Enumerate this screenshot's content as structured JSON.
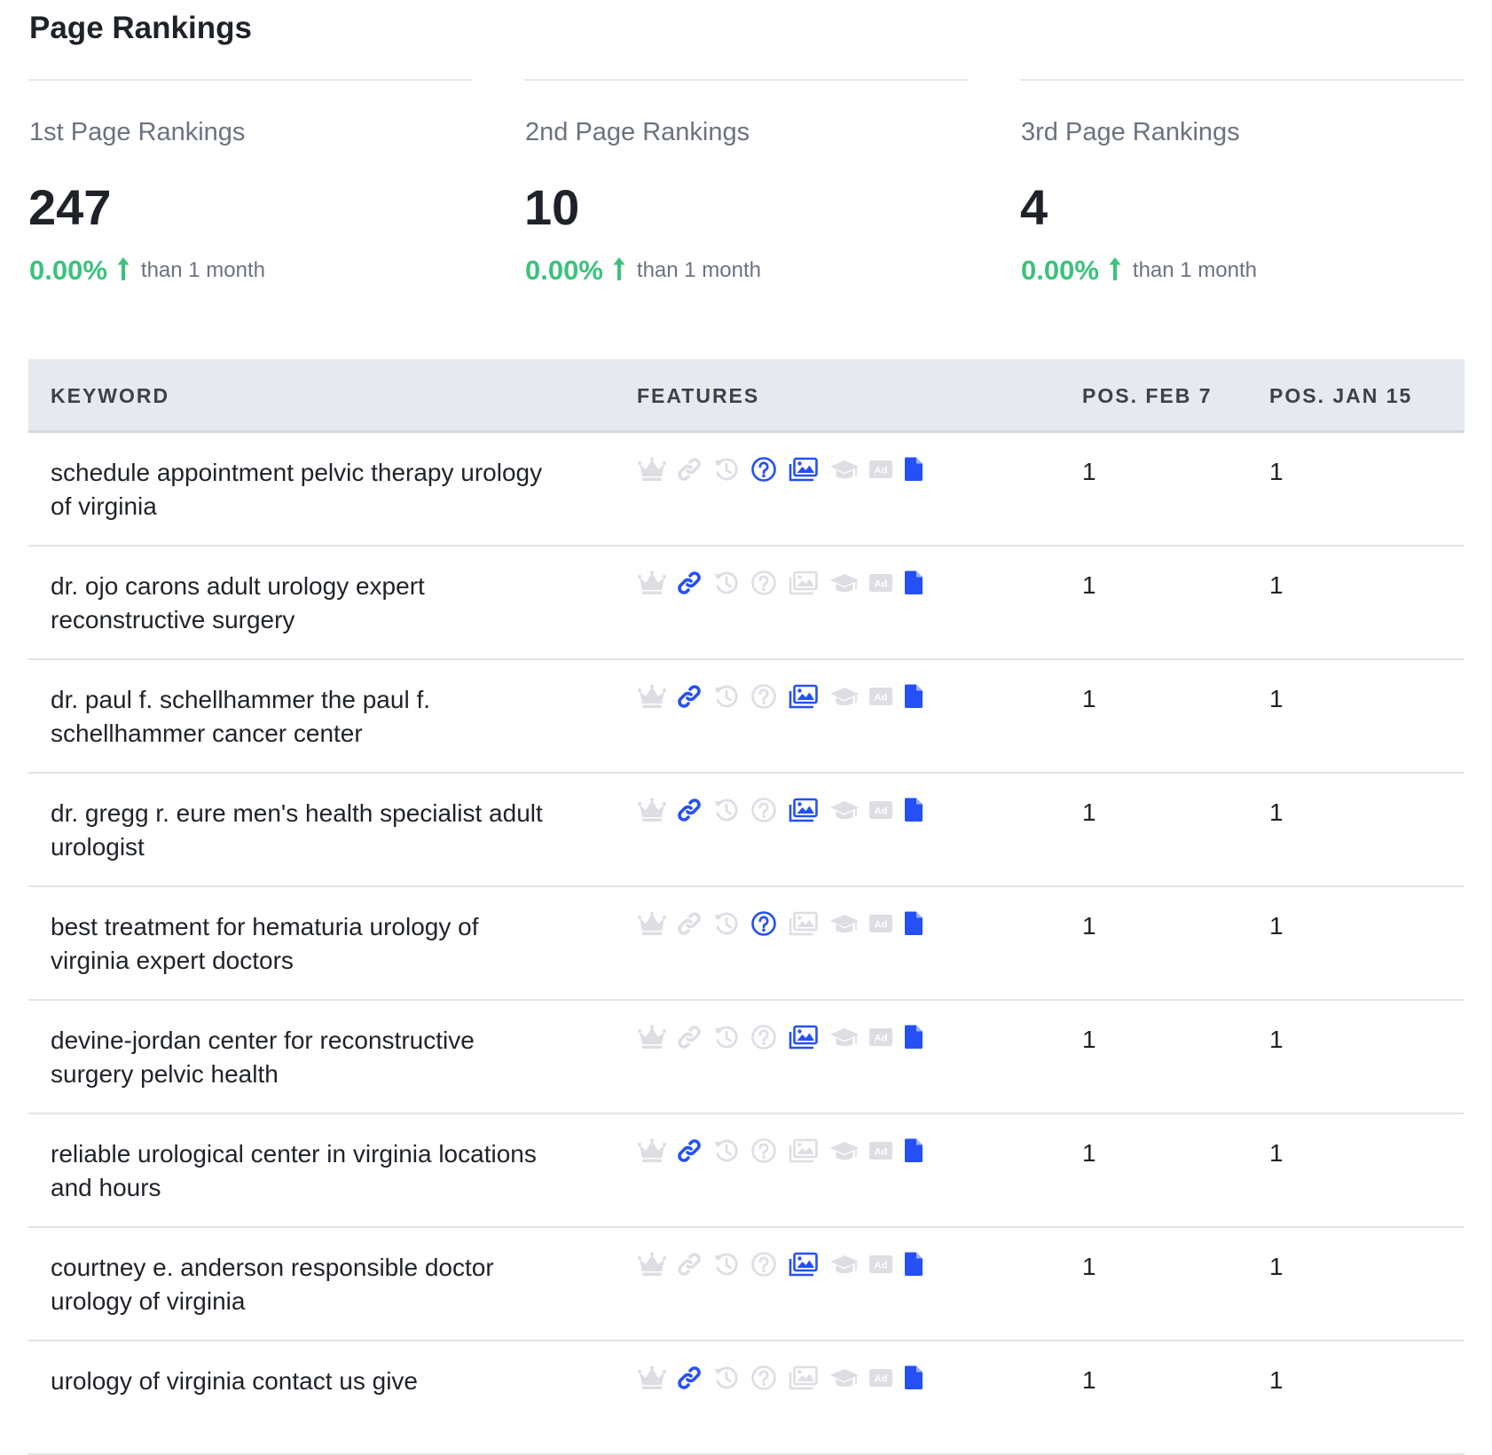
{
  "page": {
    "title": "Page Rankings"
  },
  "stats": [
    {
      "label": "1st Page Rankings",
      "value": "247",
      "change": "0.00%",
      "compare": "than 1 month"
    },
    {
      "label": "2nd Page Rankings",
      "value": "10",
      "change": "0.00%",
      "compare": "than 1 month"
    },
    {
      "label": "3rd Page Rankings",
      "value": "4",
      "change": "0.00%",
      "compare": "than 1 month"
    }
  ],
  "table": {
    "headers": {
      "keyword": "KEYWORD",
      "features": "FEATURES",
      "pos_current": "POS. FEB 7",
      "pos_previous": "POS. JAN 15"
    },
    "feature_icons": [
      "crown-icon",
      "link-icon",
      "history-icon",
      "question-icon",
      "image-icon",
      "graduation-cap-icon",
      "ad-icon",
      "document-icon"
    ],
    "ad_label": "Ad",
    "rows": [
      {
        "keyword": "schedule appointment pelvic therapy urology of virginia",
        "pos_current": "1",
        "pos_previous": "1",
        "active_features": [
          "question-icon",
          "image-icon",
          "document-icon"
        ]
      },
      {
        "keyword": "dr. ojo carons adult urology expert reconstructive surgery",
        "pos_current": "1",
        "pos_previous": "1",
        "active_features": [
          "link-icon",
          "document-icon"
        ]
      },
      {
        "keyword": "dr. paul f. schellhammer the paul f. schellhammer cancer center",
        "pos_current": "1",
        "pos_previous": "1",
        "active_features": [
          "link-icon",
          "image-icon",
          "document-icon"
        ]
      },
      {
        "keyword": "dr. gregg r. eure men's health specialist adult urologist",
        "pos_current": "1",
        "pos_previous": "1",
        "active_features": [
          "link-icon",
          "image-icon",
          "document-icon"
        ]
      },
      {
        "keyword": "best treatment for hematuria urology of virginia expert doctors",
        "pos_current": "1",
        "pos_previous": "1",
        "active_features": [
          "question-icon",
          "document-icon"
        ]
      },
      {
        "keyword": "devine-jordan center for reconstructive surgery pelvic health",
        "pos_current": "1",
        "pos_previous": "1",
        "active_features": [
          "image-icon",
          "document-icon"
        ]
      },
      {
        "keyword": "reliable urological center in virginia locations and hours",
        "pos_current": "1",
        "pos_previous": "1",
        "active_features": [
          "link-icon",
          "document-icon"
        ]
      },
      {
        "keyword": "courtney e. anderson responsible doctor urology of virginia",
        "pos_current": "1",
        "pos_previous": "1",
        "active_features": [
          "image-icon",
          "document-icon"
        ]
      },
      {
        "keyword": "urology of virginia contact us give",
        "pos_current": "1",
        "pos_previous": "1",
        "active_features": [
          "link-icon",
          "document-icon"
        ]
      }
    ]
  },
  "colors": {
    "accent_blue": "#2550f5",
    "inactive_icon": "#dcdee3",
    "positive_green": "#3ac27c",
    "header_bg": "#e6e9ee"
  }
}
